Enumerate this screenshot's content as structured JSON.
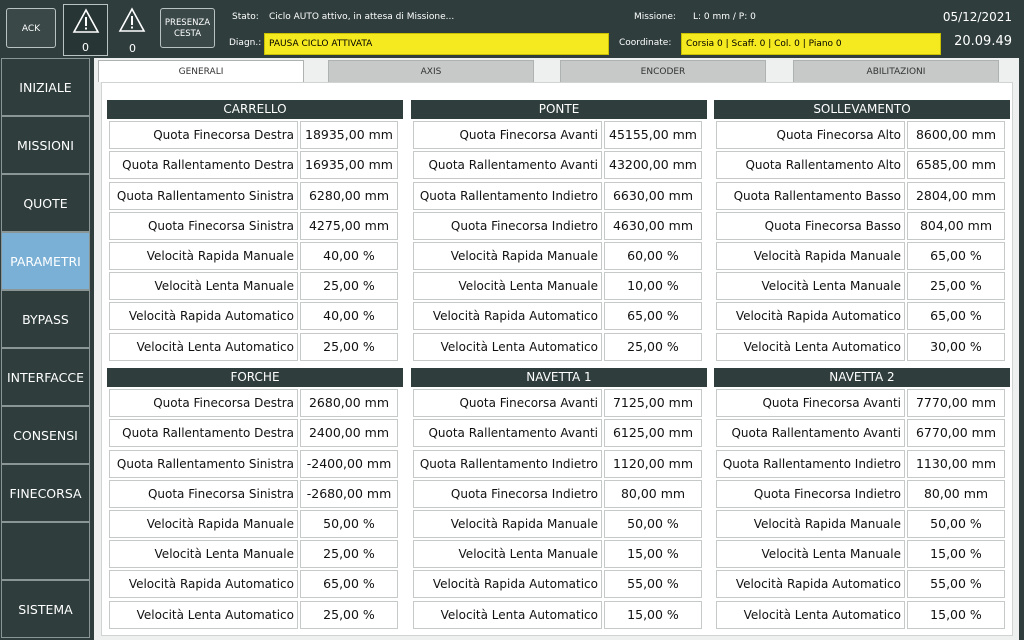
{
  "header": {
    "ack_label": "ACK",
    "alarm1_count": "0",
    "alarm2_count": "0",
    "presence_line1": "PRESENZA",
    "presence_line2": "CESTA",
    "stato_label": "Stato:",
    "stato_value": "Ciclo AUTO attivo, in attesa di Missione...",
    "diagn_label": "Diagn.:",
    "diagn_value": "PAUSA CICLO ATTIVATA",
    "missione_label": "Missione:",
    "missione_value": "L: 0 mm / P: 0",
    "coordinate_label": "Coordinate:",
    "coordinate_value": "Corsia 0 | Scaff. 0 | Col. 0 | Piano 0",
    "date": "05/12/2021",
    "time": "20.09.49",
    "highlight_color": "#f5ea1f"
  },
  "sidebar": {
    "active_color": "#7ab0d6",
    "items": [
      {
        "label": "INIZIALE"
      },
      {
        "label": "MISSIONI"
      },
      {
        "label": "QUOTE"
      },
      {
        "label": "PARAMETRI"
      },
      {
        "label": "BYPASS"
      },
      {
        "label": "INTERFACCE"
      },
      {
        "label": "CONSENSI"
      },
      {
        "label": "FINECORSA"
      },
      {
        "label": ""
      },
      {
        "label": "SISTEMA"
      }
    ]
  },
  "tabs": [
    {
      "label": "GENERALI"
    },
    {
      "label": "AXIS"
    },
    {
      "label": "ENCODER"
    },
    {
      "label": "ABILITAZIONI"
    }
  ],
  "groups": [
    {
      "title": "CARRELLO",
      "rows": [
        {
          "label": "Quota Finecorsa Destra",
          "value": "18935,00 mm"
        },
        {
          "label": "Quota Rallentamento Destra",
          "value": "16935,00 mm"
        },
        {
          "label": "Quota Rallentamento Sinistra",
          "value": "6280,00 mm"
        },
        {
          "label": "Quota Finecorsa Sinistra",
          "value": "4275,00 mm"
        },
        {
          "label": "Velocità Rapida Manuale",
          "value": "40,00 %"
        },
        {
          "label": "Velocità Lenta Manuale",
          "value": "25,00 %"
        },
        {
          "label": "Velocità Rapida Automatico",
          "value": "40,00 %"
        },
        {
          "label": "Velocità Lenta Automatico",
          "value": "25,00 %"
        }
      ]
    },
    {
      "title": "PONTE",
      "rows": [
        {
          "label": "Quota Finecorsa Avanti",
          "value": "45155,00 mm"
        },
        {
          "label": "Quota Rallentamento Avanti",
          "value": "43200,00 mm"
        },
        {
          "label": "Quota Rallentamento Indietro",
          "value": "6630,00 mm"
        },
        {
          "label": "Quota Finecorsa Indietro",
          "value": "4630,00 mm"
        },
        {
          "label": "Velocità Rapida Manuale",
          "value": "60,00 %"
        },
        {
          "label": "Velocità Lenta Manuale",
          "value": "10,00 %"
        },
        {
          "label": "Velocità Rapida Automatico",
          "value": "65,00 %"
        },
        {
          "label": "Velocità Lenta Automatico",
          "value": "25,00 %"
        }
      ]
    },
    {
      "title": "SOLLEVAMENTO",
      "rows": [
        {
          "label": "Quota Finecorsa Alto",
          "value": "8600,00 mm"
        },
        {
          "label": "Quota Rallentamento Alto",
          "value": "6585,00 mm"
        },
        {
          "label": "Quota Rallentamento Basso",
          "value": "2804,00 mm"
        },
        {
          "label": "Quota Finecorsa Basso",
          "value": "804,00 mm"
        },
        {
          "label": "Velocità Rapida Manuale",
          "value": "65,00 %"
        },
        {
          "label": "Velocità Lenta Manuale",
          "value": "25,00 %"
        },
        {
          "label": "Velocità Rapida Automatico",
          "value": "65,00 %"
        },
        {
          "label": "Velocità Lenta Automatico",
          "value": "30,00 %"
        }
      ]
    },
    {
      "title": "FORCHE",
      "rows": [
        {
          "label": "Quota Finecorsa Destra",
          "value": "2680,00 mm"
        },
        {
          "label": "Quota Rallentamento Destra",
          "value": "2400,00 mm"
        },
        {
          "label": "Quota Rallentamento Sinistra",
          "value": "-2400,00 mm"
        },
        {
          "label": "Quota Finecorsa Sinistra",
          "value": "-2680,00 mm"
        },
        {
          "label": "Velocità Rapida Manuale",
          "value": "50,00 %"
        },
        {
          "label": "Velocità Lenta Manuale",
          "value": "25,00 %"
        },
        {
          "label": "Velocità Rapida Automatico",
          "value": "65,00 %"
        },
        {
          "label": "Velocità Lenta Automatico",
          "value": "25,00 %"
        }
      ]
    },
    {
      "title": "NAVETTA 1",
      "rows": [
        {
          "label": "Quota Finecorsa Avanti",
          "value": "7125,00 mm"
        },
        {
          "label": "Quota Rallentamento Avanti",
          "value": "6125,00 mm"
        },
        {
          "label": "Quota Rallentamento Indietro",
          "value": "1120,00 mm"
        },
        {
          "label": "Quota Finecorsa Indietro",
          "value": "80,00 mm"
        },
        {
          "label": "Velocità Rapida Manuale",
          "value": "50,00 %"
        },
        {
          "label": "Velocità Lenta Manuale",
          "value": "15,00 %"
        },
        {
          "label": "Velocità Rapida Automatico",
          "value": "55,00 %"
        },
        {
          "label": "Velocità Lenta Automatico",
          "value": "15,00 %"
        }
      ]
    },
    {
      "title": "NAVETTA 2",
      "rows": [
        {
          "label": "Quota Finecorsa Avanti",
          "value": "7770,00 mm"
        },
        {
          "label": "Quota Rallentamento Avanti",
          "value": "6770,00 mm"
        },
        {
          "label": "Quota Rallentamento Indietro",
          "value": "1130,00 mm"
        },
        {
          "label": "Quota Finecorsa Indietro",
          "value": "80,00 mm"
        },
        {
          "label": "Velocità Rapida Manuale",
          "value": "50,00 %"
        },
        {
          "label": "Velocità Lenta Manuale",
          "value": "15,00 %"
        },
        {
          "label": "Velocità Rapida Automatico",
          "value": "55,00 %"
        },
        {
          "label": "Velocità Lenta Automatico",
          "value": "15,00 %"
        }
      ]
    }
  ]
}
